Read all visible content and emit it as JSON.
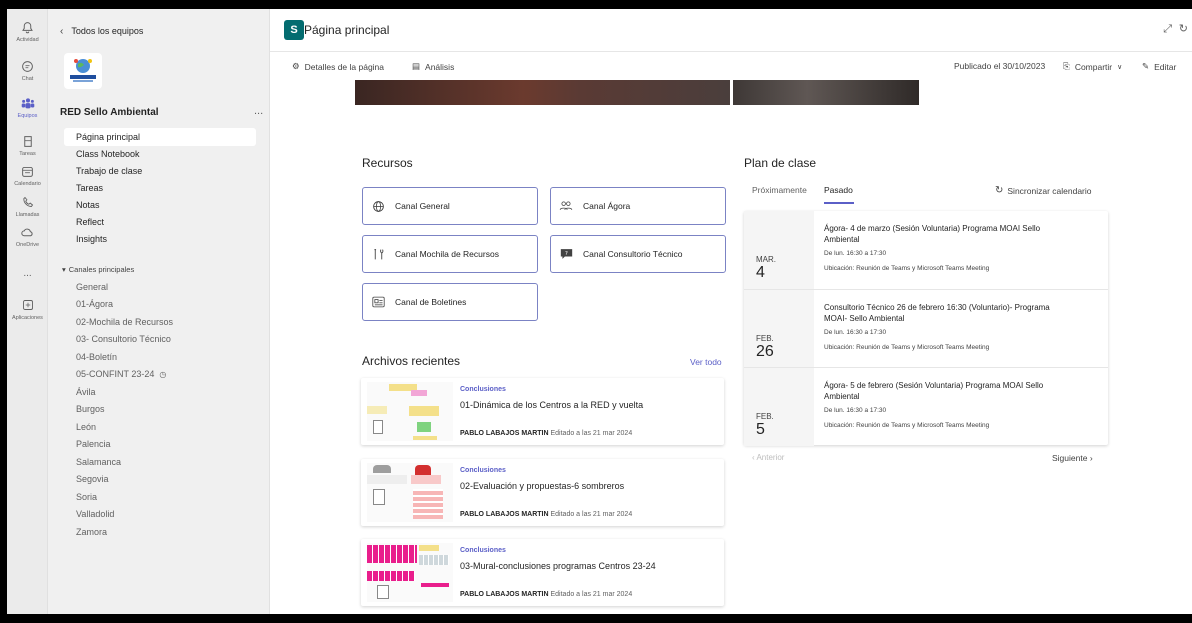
{
  "rail": {
    "items": [
      {
        "label": "Actividad",
        "icon": "bell-icon"
      },
      {
        "label": "Chat",
        "icon": "chat-icon"
      },
      {
        "label": "Equipos",
        "icon": "teams-icon"
      },
      {
        "label": "Tareas",
        "icon": "assignments-icon"
      },
      {
        "label": "Calendario",
        "icon": "calendar-icon"
      },
      {
        "label": "Llamadas",
        "icon": "phone-icon"
      },
      {
        "label": "OneDrive",
        "icon": "cloud-icon"
      },
      {
        "label": "...",
        "icon": "more-icon"
      },
      {
        "label": "Aplicaciones",
        "icon": "apps-icon"
      }
    ]
  },
  "team": {
    "back_label": "Todos los equipos",
    "name": "RED Sello Ambiental",
    "more": "...",
    "nav": [
      "Página principal",
      "Class Notebook",
      "Trabajo de clase",
      "Tareas",
      "Notas",
      "Reflect",
      "Insights"
    ],
    "channels_header": "Canales principales",
    "channels": [
      "General",
      "01-Ágora",
      "02-Mochila de Recursos",
      "03- Consultorio Técnico",
      "04-Boletín",
      "05-CONFINT 23-24",
      "Ávila",
      "Burgos",
      "León",
      "Palencia",
      "Salamanca",
      "Segovia",
      "Soria",
      "Valladolid",
      "Zamora"
    ]
  },
  "header": {
    "app_letter": "S",
    "title": "Página principal"
  },
  "cmdbar": {
    "details": "Detalles de la página",
    "analytics": "Análisis",
    "published": "Publicado el 30/10/2023",
    "share": "Compartir",
    "edit": "Editar"
  },
  "resources": {
    "title": "Recursos",
    "cards": [
      {
        "label": "Canal General",
        "icon": "globe-icon"
      },
      {
        "label": "Canal Ágora",
        "icon": "people-icon"
      },
      {
        "label": "Canal Mochila de Recursos",
        "icon": "tools-icon"
      },
      {
        "label": "Canal Consultorio Técnico",
        "icon": "help-chat-icon"
      },
      {
        "label": "Canal de Boletines",
        "icon": "newsletter-icon"
      }
    ]
  },
  "recent_files": {
    "title": "Archivos recientes",
    "see_all": "Ver todo",
    "items": [
      {
        "tag": "Conclusiones",
        "title": "01-Dinámica de los Centros a la RED y vuelta",
        "author": "PABLO LABAJOS MARTIN",
        "edited": "Editado a las 21 mar 2024"
      },
      {
        "tag": "Conclusiones",
        "title": "02-Evaluación y propuestas-6 sombreros",
        "author": "PABLO LABAJOS MARTIN",
        "edited": "Editado a las 21 mar 2024"
      },
      {
        "tag": "Conclusiones",
        "title": "03-Mural-conclusiones programas Centros 23-24",
        "author": "PABLO LABAJOS MARTIN",
        "edited": "Editado a las 21 mar 2024"
      }
    ]
  },
  "plan": {
    "title": "Plan de clase",
    "tab_upcoming": "Próximamente",
    "tab_past": "Pasado",
    "sync": "Sincronizar calendario",
    "events": [
      {
        "month": "MAR.",
        "day": "4",
        "title": "Ágora- 4 de marzo (Sesión Voluntaria) Programa MOAI Sello Ambiental",
        "time": "De lun. 16:30 a 17:30",
        "location": "Ubicación: Reunión de Teams y Microsoft Teams Meeting"
      },
      {
        "month": "FEB.",
        "day": "26",
        "title": "Consultorio Técnico 26 de febrero 16:30 (Voluntario)- Programa MOAI- Sello Ambiental",
        "time": "De lun. 16:30 a 17:30",
        "location": "Ubicación: Reunión de Teams y Microsoft Teams Meeting"
      },
      {
        "month": "FEB.",
        "day": "5",
        "title": "Ágora- 5 de febrero (Sesión Voluntaria) Programa MOAI Sello Ambiental",
        "time": "De lun. 16:30 a 17:30",
        "location": "Ubicación: Reunión de Teams y Microsoft Teams Meeting"
      }
    ],
    "prev": "Anterior",
    "next": "Siguiente"
  },
  "colors": {
    "accent": "#5b5fc7",
    "sharepoint": "#036c70"
  }
}
